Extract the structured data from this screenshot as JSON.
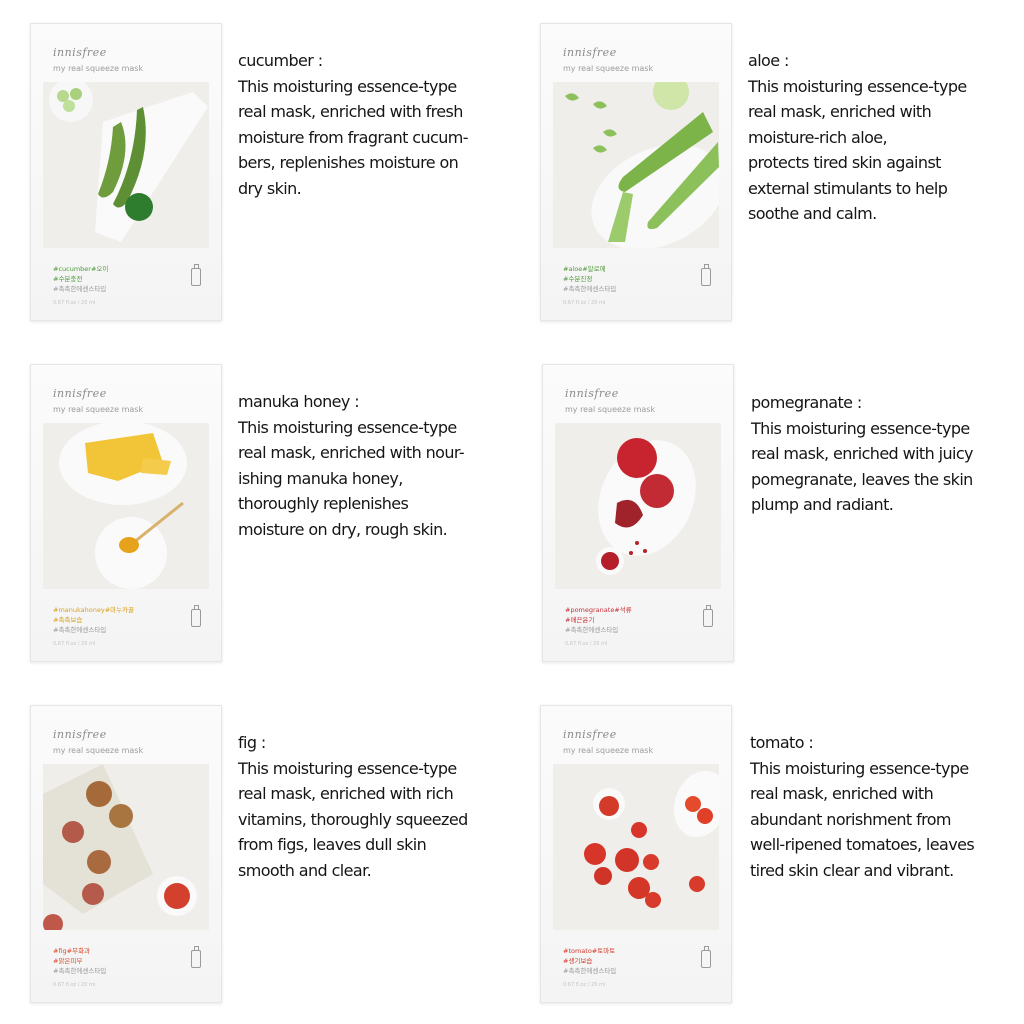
{
  "products": [
    {
      "brand": "innisfree",
      "subtitle": "my real squeeze mask",
      "tag1": "#cucumber#오이",
      "tag2": "#수분충전",
      "tag3": "#촉촉한에센스타입",
      "volume": "0.67 fl.oz / 20 ml",
      "tag_color": "#4f9a3a",
      "name": "cucumber :",
      "text": "This moisturing essence-type\nreal mask, enriched with fresh\nmoisture from fragrant cucum-\nbers, replenishes moisture on\ndry skin."
    },
    {
      "brand": "innisfree",
      "subtitle": "my real squeeze mask",
      "tag1": "#aloe#알로에",
      "tag2": "#수분진정",
      "tag3": "#촉촉한에센스타입",
      "volume": "0.67 fl.oz / 20 ml",
      "tag_color": "#4f9a3a",
      "name": "aloe :",
      "text": "This moisturing essence-type\nreal mask, enriched with\nmoisture-rich aloe,\nprotects tired skin against\nexternal stimulants to help\nsoothe and calm."
    },
    {
      "brand": "innisfree",
      "subtitle": "my real squeeze mask",
      "tag1": "#manukahoney#마누카꿀",
      "tag2": "#촉촉보습",
      "tag3": "#촉촉한에센스타입",
      "volume": "0.67 fl.oz / 20 ml",
      "tag_color": "#d9a21c",
      "name": "manuka honey :",
      "text": "This moisturing essence-type\nreal mask, enriched with nour-\nishing manuka honey,\nthoroughly replenishes\nmoisture on dry, rough skin."
    },
    {
      "brand": "innisfree",
      "subtitle": "my real squeeze mask",
      "tag1": "#pomegranate#석류",
      "tag2": "#매끈윤기",
      "tag3": "#촉촉한에센스타입",
      "volume": "0.67 fl.oz / 20 ml",
      "tag_color": "#c8323a",
      "name": "pomegranate :",
      "text": "This moisturing essence-type\nreal mask, enriched with juicy\npomegranate, leaves the skin\nplump and radiant."
    },
    {
      "brand": "innisfree",
      "subtitle": "my real squeeze mask",
      "tag1": "#fig#무화과",
      "tag2": "#맑은피부",
      "tag3": "#촉촉한에센스타입",
      "volume": "0.67 fl.oz / 20 ml",
      "tag_color": "#d84a2a",
      "name": "fig :",
      "text": "This moisturing essence-type\nreal mask, enriched with rich\nvitamins, thoroughly squeezed\nfrom figs, leaves dull skin\nsmooth and clear."
    },
    {
      "brand": "innisfree",
      "subtitle": "my real squeeze mask",
      "tag1": "#tomato#토마토",
      "tag2": "#생기보습",
      "tag3": "#촉촉한에센스타입",
      "volume": "0.67 fl.oz / 20 ml",
      "tag_color": "#d43a2a",
      "name": "tomato :",
      "text": "This moisturing essence-type\nreal mask, enriched with\nabundant norishment from\nwell-ripened tomatoes, leaves\ntired skin clear and vibrant."
    }
  ]
}
